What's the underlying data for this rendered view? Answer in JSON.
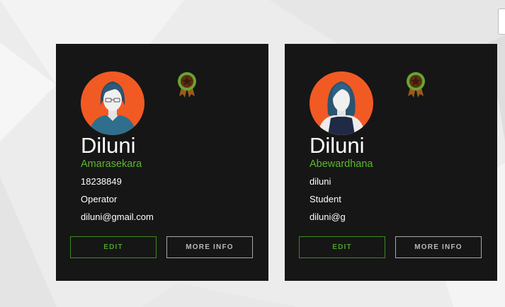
{
  "colors": {
    "card_background": "#161616",
    "avatar_background": "#f25a23",
    "last_name_accent": "#5cb82e",
    "edit_button_accent": "#4d9e2a",
    "page_background": "#ececec"
  },
  "cards": [
    {
      "first_name": "Diluni",
      "last_name": "Amarasekara",
      "id": "18238849",
      "role": "Operator",
      "email": "diluni@gmail.com",
      "edit_label": "EDIT",
      "more_info_label": "MORE INFO",
      "avatar_icon": "woman-with-glasses-avatar-icon",
      "badge_icon": "award-ribbon-icon"
    },
    {
      "first_name": "Diluni",
      "last_name": "Abewardhana",
      "id": "diluni",
      "role": "Student",
      "email": "diluni@g",
      "edit_label": "EDIT",
      "more_info_label": "MORE INFO",
      "avatar_icon": "woman-long-hair-avatar-icon",
      "badge_icon": "award-ribbon-icon"
    }
  ]
}
